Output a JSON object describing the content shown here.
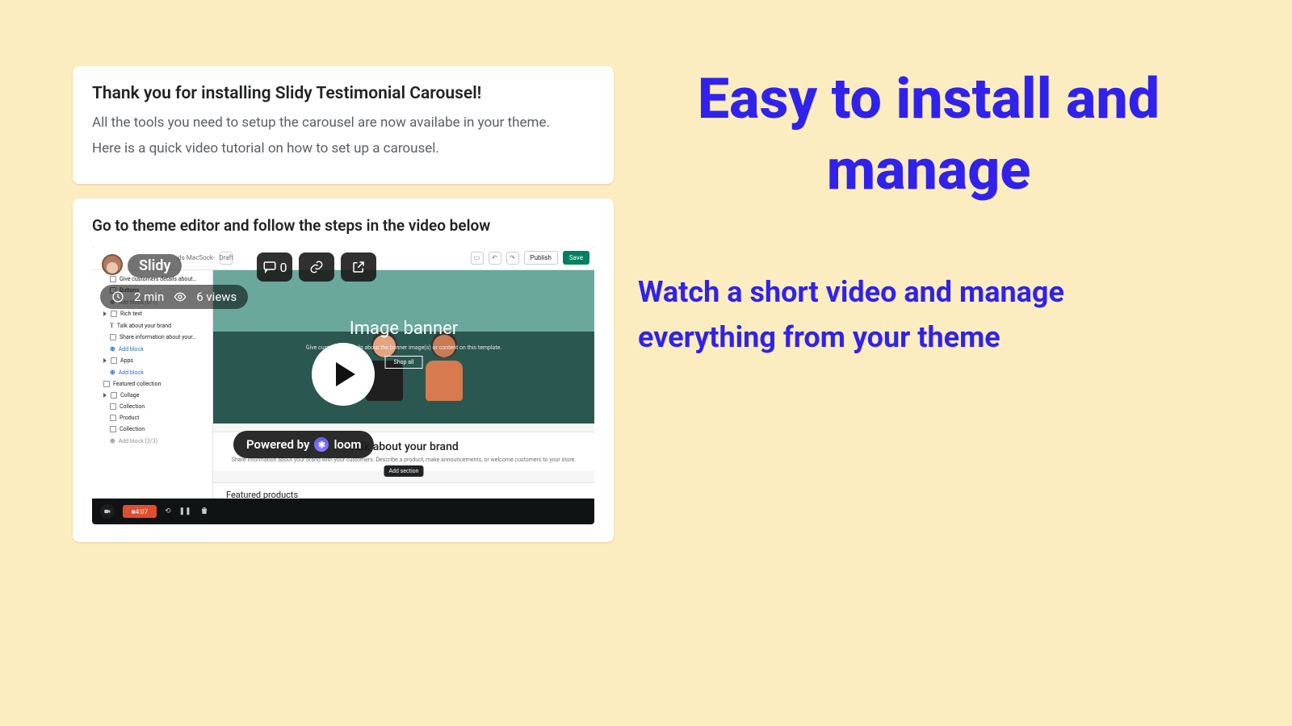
{
  "marketing": {
    "headline": "Easy to install and manage",
    "sub": "Watch a short video and manage everything from your theme"
  },
  "card1": {
    "title": "Thank you for installing Slidy Testimonial Carousel!",
    "line1": "All the tools you need to setup the carousel are now availabe in your theme.",
    "line2": "Here is a quick video tutorial on how to set up a carousel."
  },
  "card2": {
    "heading": "Go to theme editor and follow the steps in the video below"
  },
  "loom": {
    "title": "Slidy",
    "duration": "2 min",
    "views": "6 views",
    "comments": "0",
    "badge_prefix": "Powered by",
    "badge_brand": "loom",
    "timestamp": "4:07"
  },
  "editor": {
    "crumb": "ds-MacSock-",
    "draft": "Draft",
    "publish": "Publish",
    "save": "Save",
    "sidebar": {
      "s0": "Give customers details about…",
      "s1": "Buttons",
      "s2": "Add block (0/1)",
      "s3": "Rich text",
      "s4": "Talk about your brand",
      "s5": "Share information about your…",
      "s6": "Add block",
      "s7": "Apps",
      "s8": "Add block",
      "s9": "Featured collection",
      "s10": "Collage",
      "s11": "Collection",
      "s12": "Product",
      "s13": "Collection",
      "s14": "Add block (3/3)"
    },
    "canvas": {
      "banner_title": "Image banner",
      "banner_sub": "Give customers details about the banner image(s) or content on this template.",
      "shopall": "Shop all",
      "brand_title": "Talk about your brand",
      "brand_sub": "Share information about your brand with your customers. Describe a product, make announcements, or welcome customers to your store.",
      "add_section": "Add section",
      "featured": "Featured products"
    }
  }
}
